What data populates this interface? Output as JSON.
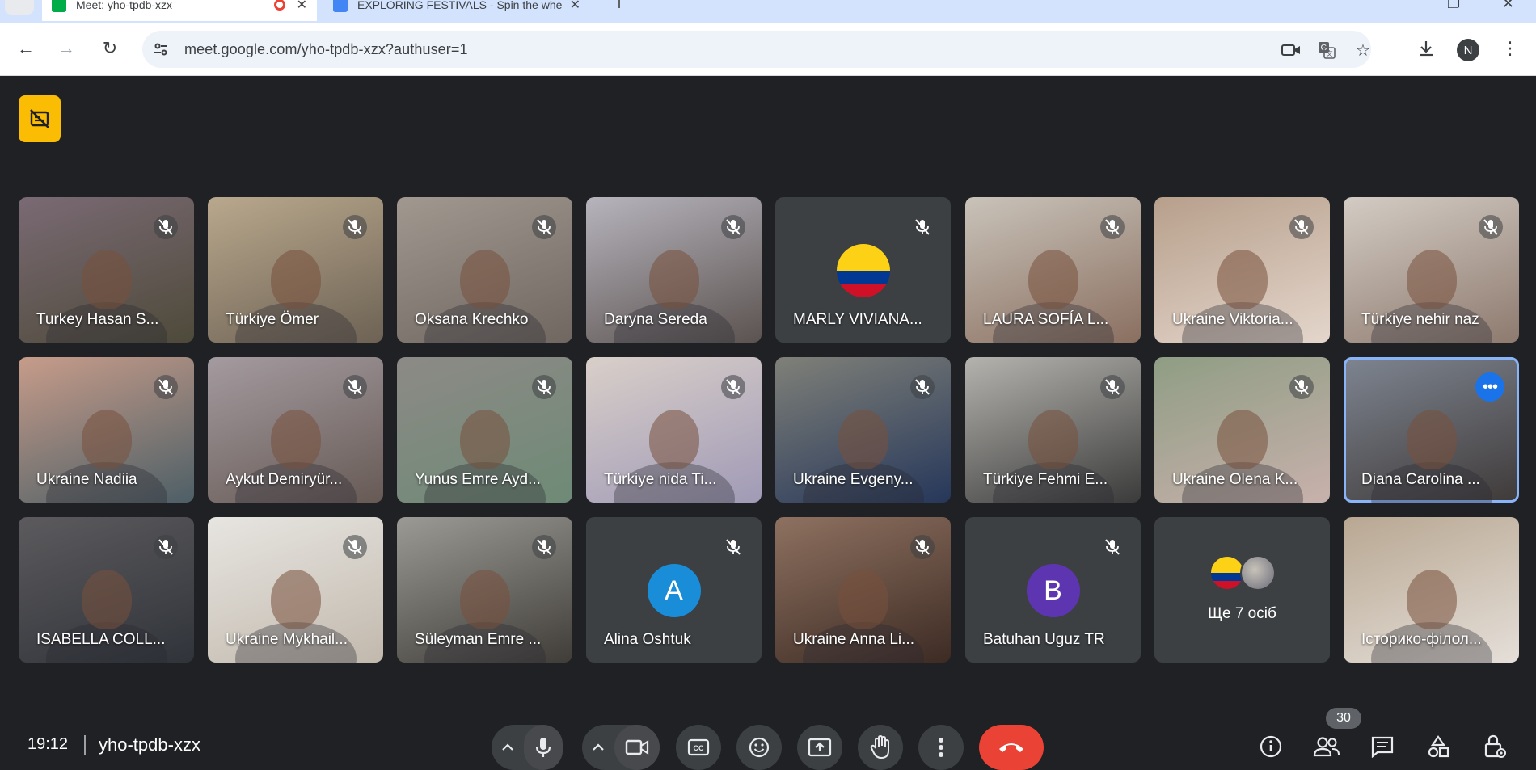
{
  "browser": {
    "tabs": [
      {
        "title": "Meet: yho-tpdb-xzx",
        "active": true,
        "favicon_color": "#00ac47"
      },
      {
        "title": "EXPLORING FESTIVALS - Spin the whe",
        "active": false,
        "favicon_color": "#4285f4"
      }
    ],
    "url": "meet.google.com/yho-tpdb-xzx?authuser=1",
    "profile_initial": "N"
  },
  "meeting": {
    "time": "19:12",
    "code": "yho-tpdb-xzx",
    "participant_count": "30",
    "participants": [
      {
        "name": "Turkey Hasan S...",
        "type": "camera",
        "muted": true,
        "c1": "#7a6a74",
        "c2": "#4e4a3a"
      },
      {
        "name": "Türkiye Ömer",
        "type": "camera",
        "muted": true,
        "c1": "#b9a88d",
        "c2": "#6d6254"
      },
      {
        "name": "Oksana Krechko",
        "type": "camera",
        "muted": true,
        "c1": "#a19890",
        "c2": "#6f6760"
      },
      {
        "name": "Daryna Sereda",
        "type": "camera",
        "muted": true,
        "c1": "#b7b4bd",
        "c2": "#5b5350"
      },
      {
        "name": "MARLY VIVIANA...",
        "type": "flag",
        "muted": true
      },
      {
        "name": "LAURA SOFÍA L...",
        "type": "camera",
        "muted": true,
        "c1": "#c9c3ba",
        "c2": "#8a6f60"
      },
      {
        "name": "Ukraine Viktoria...",
        "type": "camera",
        "muted": true,
        "c1": "#b79f8b",
        "c2": "#e4d6cc"
      },
      {
        "name": "Türkiye nehir naz",
        "type": "camera",
        "muted": true,
        "c1": "#d3ccc4",
        "c2": "#8e7a6f"
      },
      {
        "name": "Ukraine Nadiia",
        "type": "camera",
        "muted": true,
        "c1": "#c79c8a",
        "c2": "#4d5f66"
      },
      {
        "name": "Aykut Demiryür...",
        "type": "camera",
        "muted": true,
        "c1": "#a49ba0",
        "c2": "#675a55"
      },
      {
        "name": "Yunus Emre Ayd...",
        "type": "camera",
        "muted": true,
        "c1": "#8d8a86",
        "c2": "#6e8a76"
      },
      {
        "name": "Türkiye nida Ti...",
        "type": "camera",
        "muted": true,
        "c1": "#d9cfc9",
        "c2": "#a09ab6"
      },
      {
        "name": "Ukraine Evgeny...",
        "type": "camera",
        "muted": true,
        "c1": "#7f8078",
        "c2": "#26375a"
      },
      {
        "name": "Türkiye Fehmi E...",
        "type": "camera",
        "muted": true,
        "c1": "#b4b3ae",
        "c2": "#3b3b3b"
      },
      {
        "name": "Ukraine Olena K...",
        "type": "camera",
        "muted": true,
        "c1": "#8f9d84",
        "c2": "#c8b1ac"
      },
      {
        "name": "Diana Carolina ...",
        "type": "camera",
        "muted": false,
        "speaking": true,
        "c1": "#7e8591",
        "c2": "#3f3a39"
      },
      {
        "name": "ISABELLA COLL...",
        "type": "camera",
        "muted": true,
        "c1": "#5c5a5d",
        "c2": "#30343a"
      },
      {
        "name": "Ukraine Mykhail...",
        "type": "camera",
        "muted": true,
        "c1": "#e7e5e1",
        "c2": "#c2b9ad"
      },
      {
        "name": "Süleyman Emre ...",
        "type": "camera",
        "muted": true,
        "c1": "#9b9a95",
        "c2": "#403d38"
      },
      {
        "name": "Alina Oshtuk",
        "type": "avatar",
        "initial": "A",
        "avatar_color": "#1a8dd8",
        "muted": true
      },
      {
        "name": "Ukraine Anna Li...",
        "type": "camera",
        "muted": true,
        "c1": "#8e7160",
        "c2": "#3d2b24"
      },
      {
        "name": "Batuhan Uguz TR",
        "type": "avatar",
        "initial": "B",
        "avatar_color": "#5e35b1",
        "muted": true
      },
      {
        "name": "Ще 7 осіб",
        "type": "others"
      },
      {
        "name": "Історико-філол...",
        "type": "camera",
        "muted": false,
        "c1": "#b8a792",
        "c2": "#e5dfd9"
      }
    ]
  },
  "icons": {
    "badge": "no-captions-icon",
    "mute": "mic-off-icon",
    "more": "more-options-icon"
  }
}
